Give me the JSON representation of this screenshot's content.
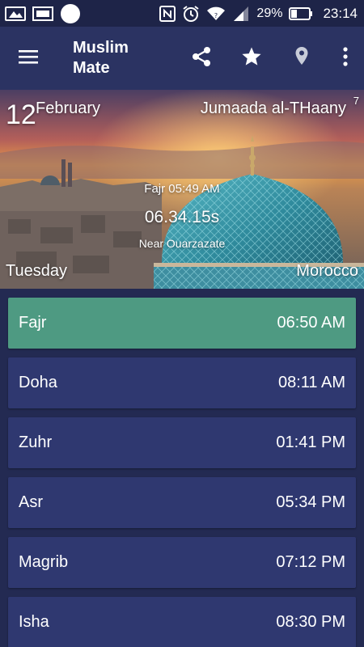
{
  "status_bar": {
    "battery_percent": "29%",
    "clock": "23:14",
    "icons": [
      "image-icon",
      "gallery-icon",
      "circle-notification-icon",
      "nfc-icon",
      "alarm-icon",
      "wifi-icon",
      "signal-icon",
      "battery-icon"
    ]
  },
  "app_bar": {
    "title_line1": "Muslim",
    "title_line2": "Mate",
    "icons": [
      "menu-icon",
      "share-icon",
      "star-icon",
      "location-pin-icon",
      "more-vert-icon"
    ]
  },
  "hero": {
    "day_number": "12",
    "month": "February",
    "hijri_month": "Jumaada al-THaany",
    "hijri_day": "7",
    "next_prayer": "Fajr 05:49 AM",
    "countdown": "06.34.15s",
    "location": "Near Ouarzazate",
    "weekday": "Tuesday",
    "country": "Morocco"
  },
  "prayers": [
    {
      "name": "Fajr",
      "time": "06:50 AM",
      "active": true
    },
    {
      "name": "Doha",
      "time": "08:11 AM",
      "active": false
    },
    {
      "name": "Zuhr",
      "time": "01:41 PM",
      "active": false
    },
    {
      "name": "Asr",
      "time": "05:34 PM",
      "active": false
    },
    {
      "name": "Magrib",
      "time": "07:12 PM",
      "active": false
    },
    {
      "name": "Isha",
      "time": "08:30 PM",
      "active": false
    }
  ],
  "colors": {
    "background": "#232a52",
    "app_bar": "#2b3362",
    "row": "#2f3870",
    "active_row": "#4e9a82"
  }
}
